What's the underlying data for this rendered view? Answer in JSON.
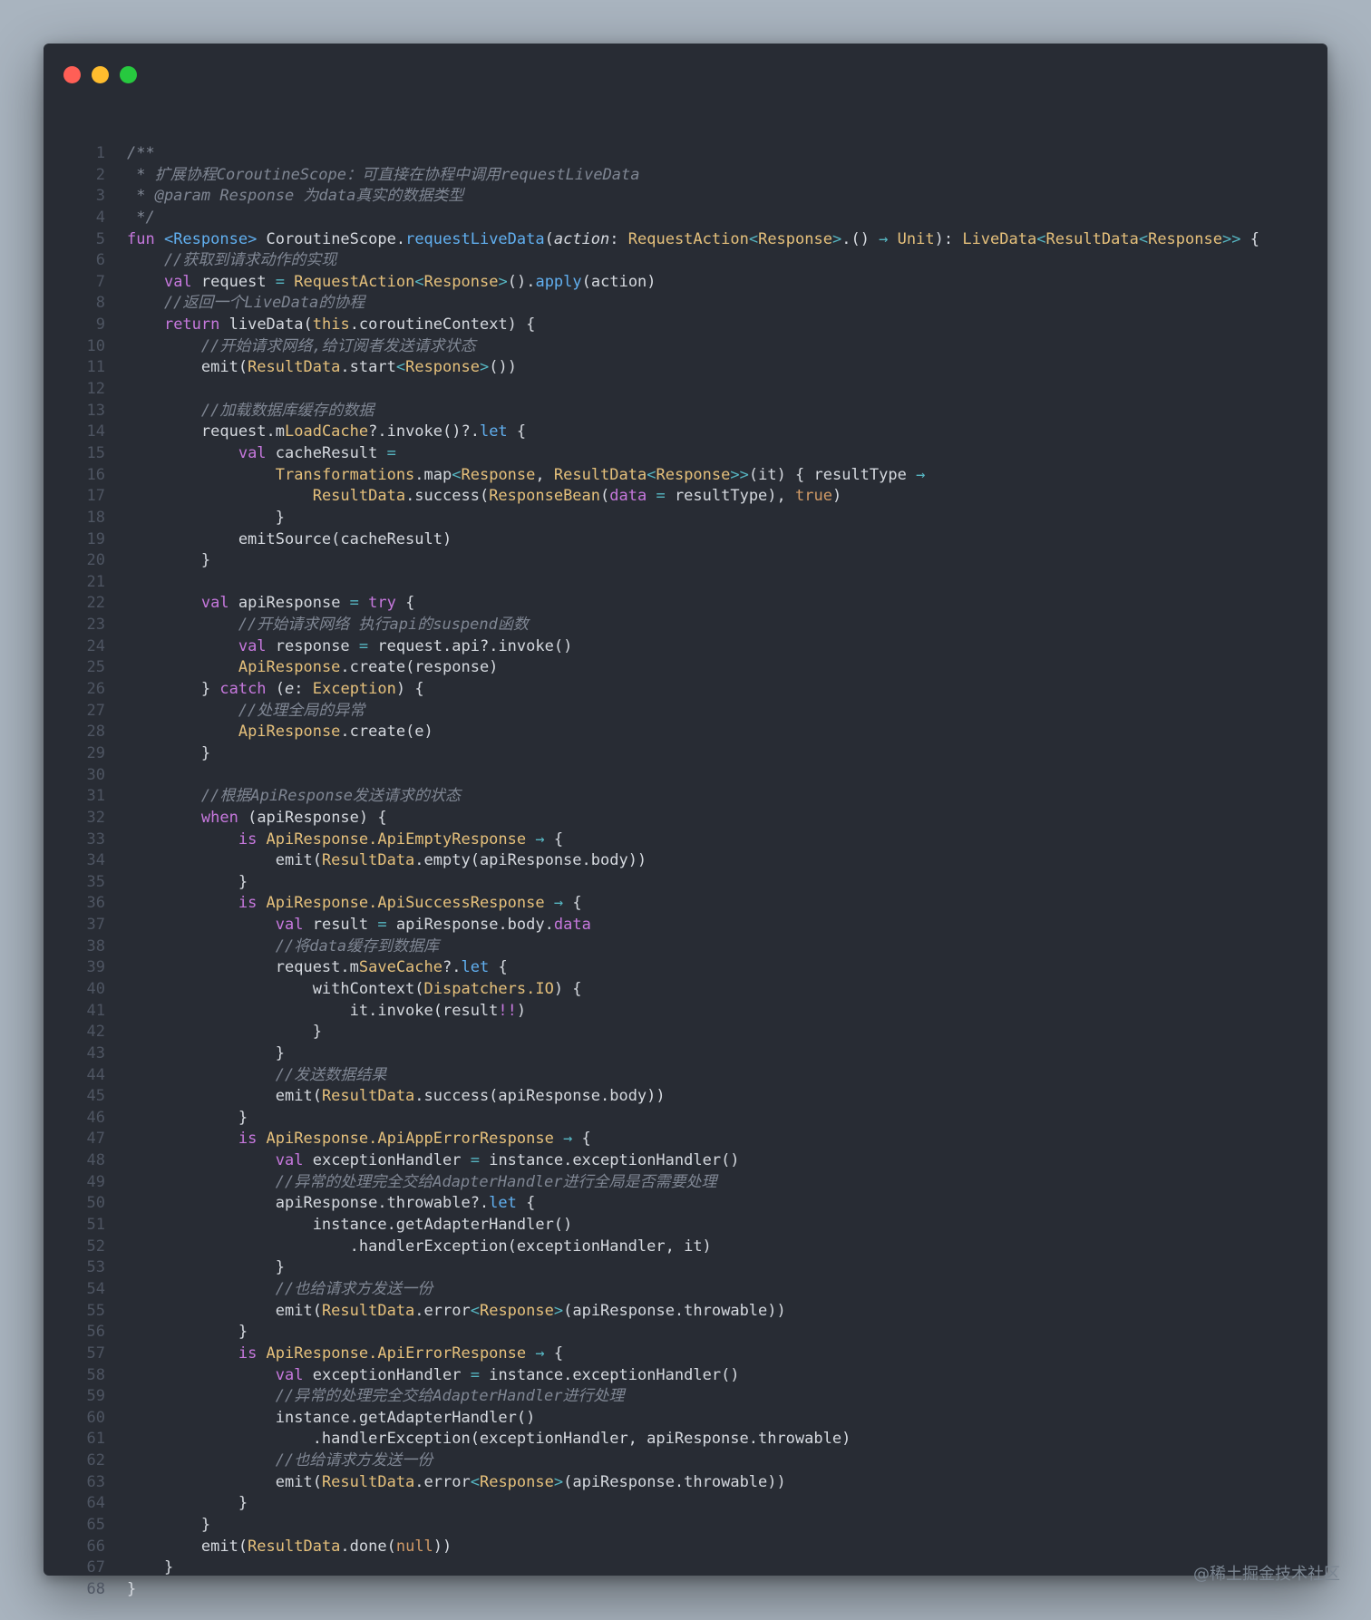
{
  "window": {
    "controls": [
      {
        "name": "close",
        "color": "#ff5f56"
      },
      {
        "name": "minimize",
        "color": "#ffbd2e"
      },
      {
        "name": "maximize",
        "color": "#27c93f"
      }
    ]
  },
  "colors": {
    "background": "#a9b4bf",
    "editor": "#282c34",
    "keyword": "#c678dd",
    "type": "#e5c07b",
    "function": "#61afef",
    "comment": "#7f8693",
    "literal": "#d19a66",
    "operator": "#56b6c2"
  },
  "code_lines": [
    [
      [
        "c",
        "/**"
      ]
    ],
    [
      [
        "c",
        " * 扩展协程CoroutineScope：可直接在协程中调用requestLiveData"
      ]
    ],
    [
      [
        "c",
        " * @param Response 为data真实的数据类型"
      ]
    ],
    [
      [
        "c",
        " */"
      ]
    ],
    [
      [
        "k",
        "fun "
      ],
      [
        "f",
        "<Response> "
      ],
      [
        "",
        "CoroutineScope."
      ],
      [
        "f",
        "requestLiveData"
      ],
      [
        "",
        "("
      ],
      [
        "it",
        "action"
      ],
      [
        "",
        ": "
      ],
      [
        "t",
        "RequestAction"
      ],
      [
        "o",
        "<"
      ],
      [
        "t",
        "Response"
      ],
      [
        "o",
        ">"
      ],
      [
        "",
        ".() "
      ],
      [
        "o",
        "→ "
      ],
      [
        "t",
        "Unit"
      ],
      [
        "",
        "): "
      ],
      [
        "t",
        "LiveData"
      ],
      [
        "o",
        "<"
      ],
      [
        "t",
        "ResultData"
      ],
      [
        "o",
        "<"
      ],
      [
        "t",
        "Response"
      ],
      [
        "o",
        ">>"
      ],
      [
        "",
        " {"
      ]
    ],
    [
      [
        "c",
        "    //获取到请求动作的实现"
      ]
    ],
    [
      [
        "",
        "    "
      ],
      [
        "k",
        "val "
      ],
      [
        "",
        "request "
      ],
      [
        "o",
        "= "
      ],
      [
        "t",
        "RequestAction"
      ],
      [
        "o",
        "<"
      ],
      [
        "t",
        "Response"
      ],
      [
        "o",
        ">"
      ],
      [
        "",
        "()."
      ],
      [
        "f",
        "apply"
      ],
      [
        "",
        "(action)"
      ]
    ],
    [
      [
        "c",
        "    //返回一个LiveData的协程"
      ]
    ],
    [
      [
        "",
        "    "
      ],
      [
        "k",
        "return "
      ],
      [
        "",
        "liveData("
      ],
      [
        "t",
        "this"
      ],
      [
        "",
        ".coroutineContext) {"
      ]
    ],
    [
      [
        "c",
        "        //开始请求网络,给订阅者发送请求状态"
      ]
    ],
    [
      [
        "",
        "        emit("
      ],
      [
        "t",
        "ResultData"
      ],
      [
        "",
        ".start"
      ],
      [
        "o",
        "<"
      ],
      [
        "t",
        "Response"
      ],
      [
        "o",
        ">"
      ],
      [
        "",
        "())"
      ]
    ],
    [
      [
        "",
        ""
      ]
    ],
    [
      [
        "c",
        "        //加载数据库缓存的数据"
      ]
    ],
    [
      [
        "",
        "        request.m"
      ],
      [
        "t",
        "LoadCache"
      ],
      [
        "",
        "?.invoke()?."
      ],
      [
        "f",
        "let"
      ],
      [
        "",
        " {"
      ]
    ],
    [
      [
        "",
        "            "
      ],
      [
        "k",
        "val "
      ],
      [
        "",
        "cacheResult "
      ],
      [
        "o",
        "="
      ]
    ],
    [
      [
        "",
        "                "
      ],
      [
        "t",
        "Transformations"
      ],
      [
        "",
        ".map"
      ],
      [
        "o",
        "<"
      ],
      [
        "t",
        "Response"
      ],
      [
        "",
        ", "
      ],
      [
        "t",
        "ResultData"
      ],
      [
        "o",
        "<"
      ],
      [
        "t",
        "Response"
      ],
      [
        "o",
        ">>"
      ],
      [
        "",
        "(it) { resultType "
      ],
      [
        "o",
        "→"
      ]
    ],
    [
      [
        "",
        "                    "
      ],
      [
        "t",
        "ResultData"
      ],
      [
        "",
        ".success("
      ],
      [
        "t",
        "ResponseBean"
      ],
      [
        "",
        "("
      ],
      [
        "pr",
        "data "
      ],
      [
        "o",
        "= "
      ],
      [
        "",
        "resultType), "
      ],
      [
        "p",
        "true"
      ],
      [
        "",
        ")"
      ]
    ],
    [
      [
        "",
        "                }"
      ]
    ],
    [
      [
        "",
        "            emitSource(cacheResult)"
      ]
    ],
    [
      [
        "",
        "        }"
      ]
    ],
    [
      [
        "",
        ""
      ]
    ],
    [
      [
        "",
        "        "
      ],
      [
        "k",
        "val "
      ],
      [
        "",
        "apiResponse "
      ],
      [
        "o",
        "= "
      ],
      [
        "k",
        "try"
      ],
      [
        "",
        " {"
      ]
    ],
    [
      [
        "c",
        "            //开始请求网络 执行api的suspend函数"
      ]
    ],
    [
      [
        "",
        "            "
      ],
      [
        "k",
        "val "
      ],
      [
        "",
        "response "
      ],
      [
        "o",
        "= "
      ],
      [
        "",
        "request.api?.invoke()"
      ]
    ],
    [
      [
        "",
        "            "
      ],
      [
        "t",
        "ApiResponse"
      ],
      [
        "",
        ".create(response)"
      ]
    ],
    [
      [
        "",
        "        } "
      ],
      [
        "k",
        "catch "
      ],
      [
        "",
        "("
      ],
      [
        "it",
        "e"
      ],
      [
        "",
        ": "
      ],
      [
        "t",
        "Exception"
      ],
      [
        "",
        ") {"
      ]
    ],
    [
      [
        "c",
        "            //处理全局的异常"
      ]
    ],
    [
      [
        "",
        "            "
      ],
      [
        "t",
        "ApiResponse"
      ],
      [
        "",
        ".create(e)"
      ]
    ],
    [
      [
        "",
        "        }"
      ]
    ],
    [
      [
        "",
        ""
      ]
    ],
    [
      [
        "c",
        "        //根据ApiResponse发送请求的状态"
      ]
    ],
    [
      [
        "",
        "        "
      ],
      [
        "k",
        "when "
      ],
      [
        "",
        "(apiResponse) {"
      ]
    ],
    [
      [
        "",
        "            "
      ],
      [
        "k",
        "is "
      ],
      [
        "t",
        "ApiResponse.ApiEmptyResponse "
      ],
      [
        "o",
        "→ "
      ],
      [
        "",
        "{"
      ]
    ],
    [
      [
        "",
        "                emit("
      ],
      [
        "t",
        "ResultData"
      ],
      [
        "",
        ".empty(apiResponse.body))"
      ]
    ],
    [
      [
        "",
        "            }"
      ]
    ],
    [
      [
        "",
        "            "
      ],
      [
        "k",
        "is "
      ],
      [
        "t",
        "ApiResponse.ApiSuccessResponse "
      ],
      [
        "o",
        "→ "
      ],
      [
        "",
        "{"
      ]
    ],
    [
      [
        "",
        "                "
      ],
      [
        "k",
        "val "
      ],
      [
        "",
        "result "
      ],
      [
        "o",
        "= "
      ],
      [
        "",
        "apiResponse.body."
      ],
      [
        "pr",
        "data"
      ]
    ],
    [
      [
        "c",
        "                //将data缓存到数据库"
      ]
    ],
    [
      [
        "",
        "                request.m"
      ],
      [
        "t",
        "SaveCache"
      ],
      [
        "",
        "?."
      ],
      [
        "f",
        "let"
      ],
      [
        "",
        " {"
      ]
    ],
    [
      [
        "",
        "                    withContext("
      ],
      [
        "t",
        "Dispatchers.IO"
      ],
      [
        "",
        ") {"
      ]
    ],
    [
      [
        "",
        "                        it.invoke(result"
      ],
      [
        "k",
        "!!"
      ],
      [
        "",
        ")"
      ]
    ],
    [
      [
        "",
        "                    }"
      ]
    ],
    [
      [
        "",
        "                }"
      ]
    ],
    [
      [
        "c",
        "                //发送数据结果"
      ]
    ],
    [
      [
        "",
        "                emit("
      ],
      [
        "t",
        "ResultData"
      ],
      [
        "",
        ".success(apiResponse.body))"
      ]
    ],
    [
      [
        "",
        "            }"
      ]
    ],
    [
      [
        "",
        "            "
      ],
      [
        "k",
        "is "
      ],
      [
        "t",
        "ApiResponse.ApiAppErrorResponse "
      ],
      [
        "o",
        "→ "
      ],
      [
        "",
        "{"
      ]
    ],
    [
      [
        "",
        "                "
      ],
      [
        "k",
        "val "
      ],
      [
        "",
        "exceptionHandler "
      ],
      [
        "o",
        "= "
      ],
      [
        "",
        "instance.exceptionHandler()"
      ]
    ],
    [
      [
        "c",
        "                //异常的处理完全交给AdapterHandler进行全局是否需要处理"
      ]
    ],
    [
      [
        "",
        "                apiResponse.throwable?."
      ],
      [
        "f",
        "let"
      ],
      [
        "",
        " {"
      ]
    ],
    [
      [
        "",
        "                    instance.getAdapterHandler()"
      ]
    ],
    [
      [
        "",
        "                        .handlerException(exceptionHandler, it)"
      ]
    ],
    [
      [
        "",
        "                }"
      ]
    ],
    [
      [
        "c",
        "                //也给请求方发送一份"
      ]
    ],
    [
      [
        "",
        "                emit("
      ],
      [
        "t",
        "ResultData"
      ],
      [
        "",
        ".error"
      ],
      [
        "o",
        "<"
      ],
      [
        "t",
        "Response"
      ],
      [
        "o",
        ">"
      ],
      [
        "",
        "(apiResponse.throwable))"
      ]
    ],
    [
      [
        "",
        "            }"
      ]
    ],
    [
      [
        "",
        "            "
      ],
      [
        "k",
        "is "
      ],
      [
        "t",
        "ApiResponse.ApiErrorResponse "
      ],
      [
        "o",
        "→ "
      ],
      [
        "",
        "{"
      ]
    ],
    [
      [
        "",
        "                "
      ],
      [
        "k",
        "val "
      ],
      [
        "",
        "exceptionHandler "
      ],
      [
        "o",
        "= "
      ],
      [
        "",
        "instance.exceptionHandler()"
      ]
    ],
    [
      [
        "c",
        "                //异常的处理完全交给AdapterHandler进行处理"
      ]
    ],
    [
      [
        "",
        "                instance.getAdapterHandler()"
      ]
    ],
    [
      [
        "",
        "                    .handlerException(exceptionHandler, apiResponse.throwable)"
      ]
    ],
    [
      [
        "c",
        "                //也给请求方发送一份"
      ]
    ],
    [
      [
        "",
        "                emit("
      ],
      [
        "t",
        "ResultData"
      ],
      [
        "",
        ".error"
      ],
      [
        "o",
        "<"
      ],
      [
        "t",
        "Response"
      ],
      [
        "o",
        ">"
      ],
      [
        "",
        "(apiResponse.throwable))"
      ]
    ],
    [
      [
        "",
        "            }"
      ]
    ],
    [
      [
        "",
        "        }"
      ]
    ],
    [
      [
        "",
        "        emit("
      ],
      [
        "t",
        "ResultData"
      ],
      [
        "",
        ".done("
      ],
      [
        "p",
        "null"
      ],
      [
        "",
        "))"
      ]
    ],
    [
      [
        "",
        "    }"
      ]
    ],
    [
      [
        "",
        "}"
      ]
    ]
  ],
  "watermark": "@稀土掘金技术社区"
}
